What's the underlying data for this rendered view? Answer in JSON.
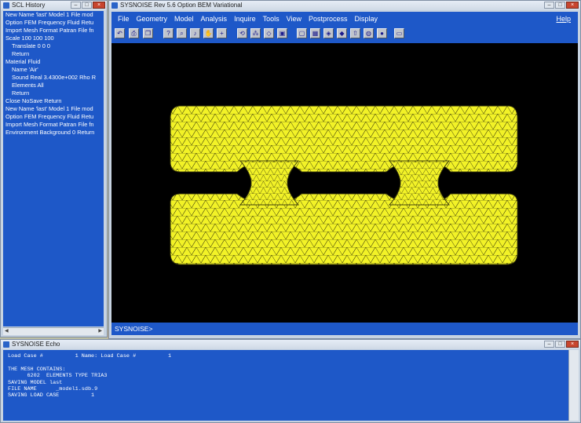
{
  "scl_window": {
    "title": "SCL History",
    "lines": [
      {
        "text": "New Name 'last' Model 1 File mod",
        "indent": false
      },
      {
        "text": "Option  FEM Frequency Fluid Retu",
        "indent": false
      },
      {
        "text": "Import Mesh Format Patran File fn",
        "indent": false
      },
      {
        "text": "Scale  100  100  100",
        "indent": false
      },
      {
        "text": "Translate  0  0  0",
        "indent": true
      },
      {
        "text": "Return",
        "indent": true
      },
      {
        "text": "Material Fluid",
        "indent": false
      },
      {
        "text": "Name 'Air'",
        "indent": true
      },
      {
        "text": "Sound Real 3.4300e+002  Rho R",
        "indent": true
      },
      {
        "text": "Elements All",
        "indent": true
      },
      {
        "text": "Return",
        "indent": true
      },
      {
        "text": "Close NoSave Return",
        "indent": false
      },
      {
        "text": "New Name 'last' Model 1 File mod",
        "indent": false
      },
      {
        "text": "Option  FEM Frequency Fluid Retu",
        "indent": false
      },
      {
        "text": "Import Mesh Format Patran File fn",
        "indent": false
      },
      {
        "text": "Environment Background 0 Return",
        "indent": false
      }
    ]
  },
  "main_window": {
    "title": "SYSNOISE Rev 5.6 Option BEM Variational",
    "menu": [
      {
        "label": "File",
        "id": "file"
      },
      {
        "label": "Geometry",
        "id": "geometry"
      },
      {
        "label": "Model",
        "id": "model"
      },
      {
        "label": "Analysis",
        "id": "analysis"
      },
      {
        "label": "Inquire",
        "id": "inquire"
      },
      {
        "label": "Tools",
        "id": "tools"
      },
      {
        "label": "View",
        "id": "view"
      },
      {
        "label": "Postprocess",
        "id": "postprocess"
      },
      {
        "label": "Display",
        "id": "display"
      }
    ],
    "help_label": "Help",
    "toolbar_icons": [
      "undo-icon",
      "print-icon",
      "copy-icon",
      "help-query-icon",
      "zoom-icon",
      "bell-icon",
      "hand-icon",
      "crosshair-icon",
      "rotate-icon",
      "select-node-icon",
      "pick-icon",
      "cube-icon",
      "frame-icon",
      "grid-icon",
      "node-icon",
      "element-icon",
      "arrow-up-icon",
      "globe-icon",
      "palette-icon",
      "screen-icon"
    ],
    "prompt": "SYSNOISE>",
    "model_color": "#f2f227",
    "mesh_line_color": "#3a3a0a",
    "background_color": "#000000"
  },
  "echo_window": {
    "title": "SYSNOISE Echo",
    "lines": [
      "Load Case #          1 Name: Load Case #          1",
      "",
      "THE MESH CONTAINS:",
      "      6202  ELEMENTS TYPE TRIA3",
      "SAVING MODEL last",
      "FILE NAME      _model1.sdb.9",
      "SAVING LOAD CASE          1"
    ]
  },
  "accent_color": "#1e58c8"
}
